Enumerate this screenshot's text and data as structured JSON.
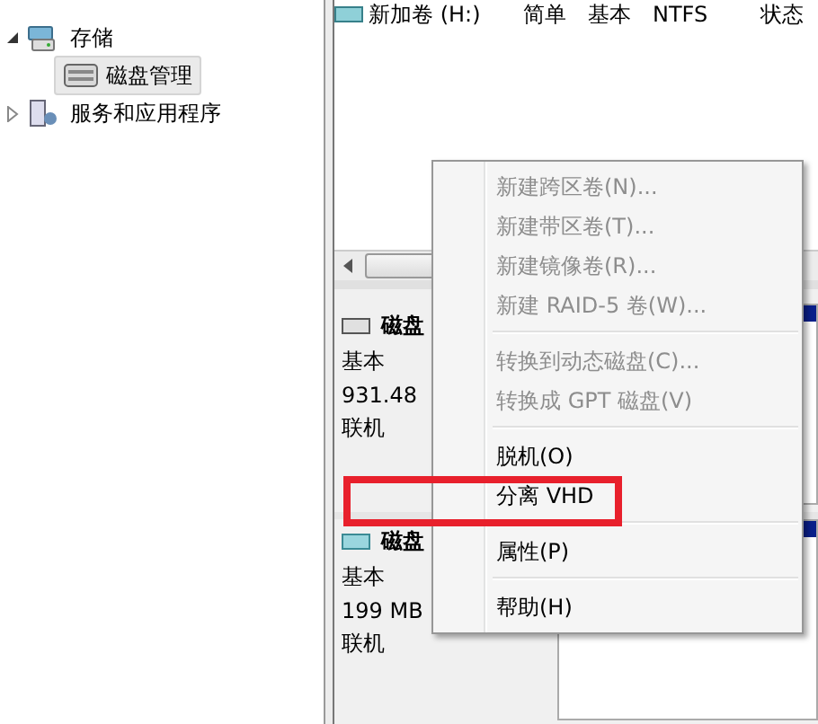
{
  "tree": [
    {
      "label": "存储",
      "kind": "storage",
      "expanded": true,
      "selected": false,
      "children": [
        {
          "label": "磁盘管理",
          "kind": "disk",
          "selected": true
        }
      ]
    },
    {
      "label": "服务和应用程序",
      "kind": "services",
      "expanded": false,
      "selected": false
    }
  ],
  "volumes": [
    {
      "name": "新加卷 (H:)",
      "layout": "简单",
      "type": "基本",
      "filesystem": "NTFS",
      "status": "状态"
    }
  ],
  "disks": [
    {
      "kind": "physical",
      "name": "磁盘",
      "type": "基本",
      "size": "931.48",
      "state": "联机"
    },
    {
      "kind": "virtual",
      "name": "磁盘",
      "type": "基本",
      "size": "199 MB",
      "state": "联机"
    }
  ],
  "context_menu": [
    {
      "kind": "item",
      "label": "新建跨区卷(N)...",
      "disabled": true,
      "highlighted": false
    },
    {
      "kind": "item",
      "label": "新建带区卷(T)...",
      "disabled": true,
      "highlighted": false
    },
    {
      "kind": "item",
      "label": "新建镜像卷(R)...",
      "disabled": true,
      "highlighted": false
    },
    {
      "kind": "item",
      "label": "新建 RAID-5 卷(W)...",
      "disabled": true,
      "highlighted": false
    },
    {
      "kind": "separator"
    },
    {
      "kind": "item",
      "label": "转换到动态磁盘(C)...",
      "disabled": true,
      "highlighted": false
    },
    {
      "kind": "item",
      "label": "转换成 GPT 磁盘(V)",
      "disabled": true,
      "highlighted": false
    },
    {
      "kind": "separator"
    },
    {
      "kind": "item",
      "label": "脱机(O)",
      "disabled": false,
      "highlighted": false
    },
    {
      "kind": "item",
      "label": "分离 VHD",
      "disabled": false,
      "highlighted": true
    },
    {
      "kind": "separator"
    },
    {
      "kind": "item",
      "label": "属性(P)",
      "disabled": false,
      "highlighted": false
    },
    {
      "kind": "separator"
    },
    {
      "kind": "item",
      "label": "帮助(H)",
      "disabled": false,
      "highlighted": false
    }
  ]
}
